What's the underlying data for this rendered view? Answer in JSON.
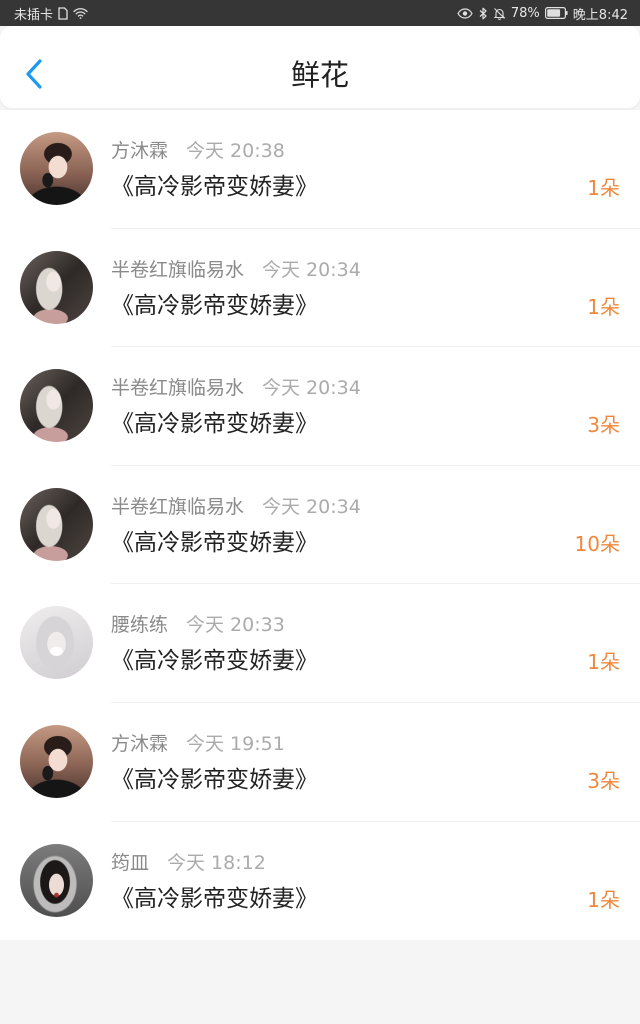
{
  "status_bar": {
    "carrier": "未插卡",
    "battery_percent": "78%",
    "battery_level": 0.78,
    "time": "晚上8:42",
    "icons": [
      "sim-card-icon",
      "wifi-icon",
      "eye-icon",
      "bluetooth-icon",
      "bell-off-icon",
      "battery-icon"
    ]
  },
  "header": {
    "title": "鲜花",
    "back_icon": "chevron-left-icon"
  },
  "colors": {
    "accent": "#1b9af0",
    "count": "#f0883c",
    "status_bar_bg": "#363636",
    "name": "#8a8a8a",
    "time": "#ababab",
    "book": "#222222"
  },
  "gifts": [
    {
      "name": "方沐霖",
      "time": "今天 20:38",
      "book": "《高冷影帝变娇妻》",
      "count": "1朵"
    },
    {
      "name": "半卷红旗临易水",
      "time": "今天 20:34",
      "book": "《高冷影帝变娇妻》",
      "count": "1朵"
    },
    {
      "name": "半卷红旗临易水",
      "time": "今天 20:34",
      "book": "《高冷影帝变娇妻》",
      "count": "3朵"
    },
    {
      "name": "半卷红旗临易水",
      "time": "今天 20:34",
      "book": "《高冷影帝变娇妻》",
      "count": "10朵"
    },
    {
      "name": "腰练练",
      "time": "今天 20:33",
      "book": "《高冷影帝变娇妻》",
      "count": "1朵"
    },
    {
      "name": "方沐霖",
      "time": "今天 19:51",
      "book": "《高冷影帝变娇妻》",
      "count": "3朵"
    },
    {
      "name": "筠皿",
      "time": "今天 18:12",
      "book": "《高冷影帝变娇妻》",
      "count": "1朵"
    }
  ]
}
